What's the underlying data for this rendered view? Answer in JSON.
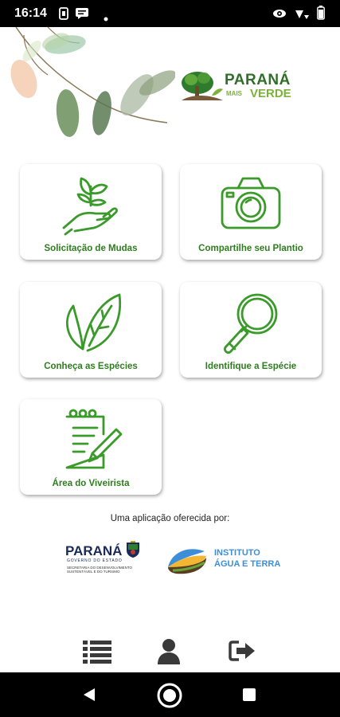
{
  "status_bar": {
    "time": "16:14",
    "icons": [
      "sim-card-icon",
      "message-icon",
      "notification-dot-icon",
      "eye-icon",
      "wifi-icon",
      "battery-icon"
    ]
  },
  "brand": {
    "line1": "PARANÁ",
    "line2_small": "MAIS",
    "line2_big": "VERDE",
    "colors": {
      "dark_green": "#2f6f2a",
      "light_green": "#7bb33a"
    }
  },
  "menu": {
    "items": [
      {
        "label": "Solicitação de Mudas",
        "icon": "hand-sprout-icon"
      },
      {
        "label": "Compartilhe seu Plantio",
        "icon": "camera-icon"
      },
      {
        "label": "Conheça as Espécies",
        "icon": "leaf-icon"
      },
      {
        "label": "Identifique a Espécie",
        "icon": "magnifier-icon"
      },
      {
        "label": "Área do Viveirista",
        "icon": "notepad-pencil-icon"
      }
    ],
    "accent_color": "#2e7d1e"
  },
  "footer": {
    "offered_by": "Uma aplicação oferecida por:",
    "partners": [
      {
        "name": "PARANÁ",
        "subtitle": "GOVERNO DO ESTADO",
        "detail": "SECRETARIA DO DESENVOLVIMENTO SUSTENTÁVEL E DO TURISMO"
      },
      {
        "name_line1": "INSTITUTO",
        "name_line2": "ÁGUA E TERRA"
      }
    ]
  },
  "bottom_nav": {
    "items": [
      {
        "icon": "list-icon"
      },
      {
        "icon": "user-icon"
      },
      {
        "icon": "logout-icon"
      }
    ]
  },
  "system_nav": {
    "items": [
      {
        "icon": "back-icon"
      },
      {
        "icon": "home-icon"
      },
      {
        "icon": "recents-icon"
      }
    ]
  }
}
